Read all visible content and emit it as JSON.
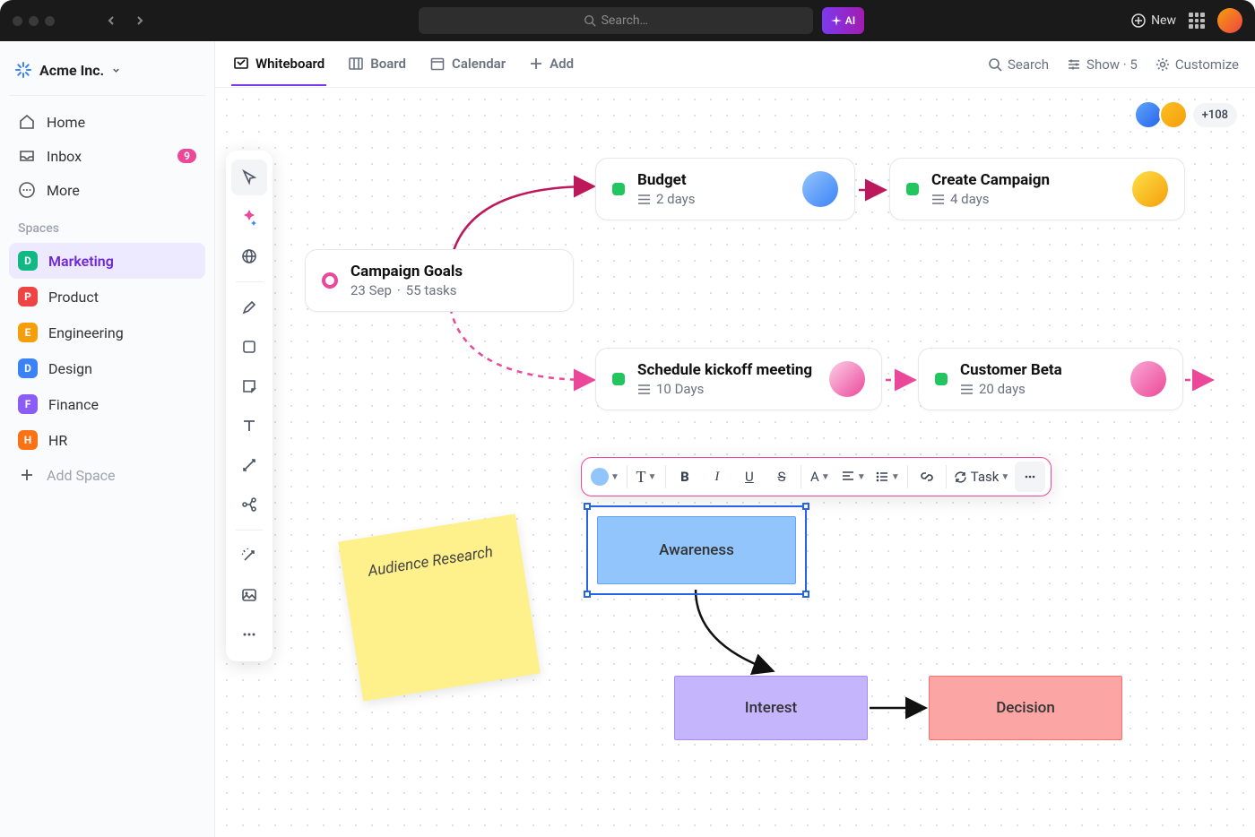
{
  "topbar": {
    "search_placeholder": "Search…",
    "ai_label": "AI",
    "new_label": "New"
  },
  "workspace": {
    "name": "Acme Inc."
  },
  "sidebar": {
    "items": [
      {
        "label": "Home"
      },
      {
        "label": "Inbox",
        "badge": "9"
      },
      {
        "label": "More"
      }
    ],
    "spaces_label": "Spaces",
    "spaces": [
      {
        "initial": "D",
        "label": "Marketing",
        "color": "#10b981",
        "active": true
      },
      {
        "initial": "P",
        "label": "Product",
        "color": "#ef4444"
      },
      {
        "initial": "E",
        "label": "Engineering",
        "color": "#f59e0b"
      },
      {
        "initial": "D",
        "label": "Design",
        "color": "#3b82f6"
      },
      {
        "initial": "F",
        "label": "Finance",
        "color": "#8b5cf6"
      },
      {
        "initial": "H",
        "label": "HR",
        "color": "#f97316"
      }
    ],
    "add_space": "Add Space"
  },
  "tabs": {
    "items": [
      {
        "label": "Whiteboard",
        "active": true
      },
      {
        "label": "Board"
      },
      {
        "label": "Calendar"
      },
      {
        "label": "Add"
      }
    ],
    "right": {
      "search": "Search",
      "show": "Show · 5",
      "customize": "Customize"
    }
  },
  "presence": {
    "extra": "+108"
  },
  "cards": {
    "goals": {
      "title": "Campaign Goals",
      "date": "23 Sep",
      "tasks": "55 tasks"
    },
    "budget": {
      "title": "Budget",
      "meta": "2 days"
    },
    "create": {
      "title": "Create Campaign",
      "meta": "4 days"
    },
    "kickoff": {
      "title": "Schedule kickoff meeting",
      "meta": "10 Days"
    },
    "beta": {
      "title": "Customer Beta",
      "meta": "20 days"
    }
  },
  "sticky": {
    "text": "Audience Research"
  },
  "flow": {
    "awareness": "Awareness",
    "interest": "Interest",
    "decision": "Decision"
  },
  "fmtbar": {
    "task": "Task"
  }
}
